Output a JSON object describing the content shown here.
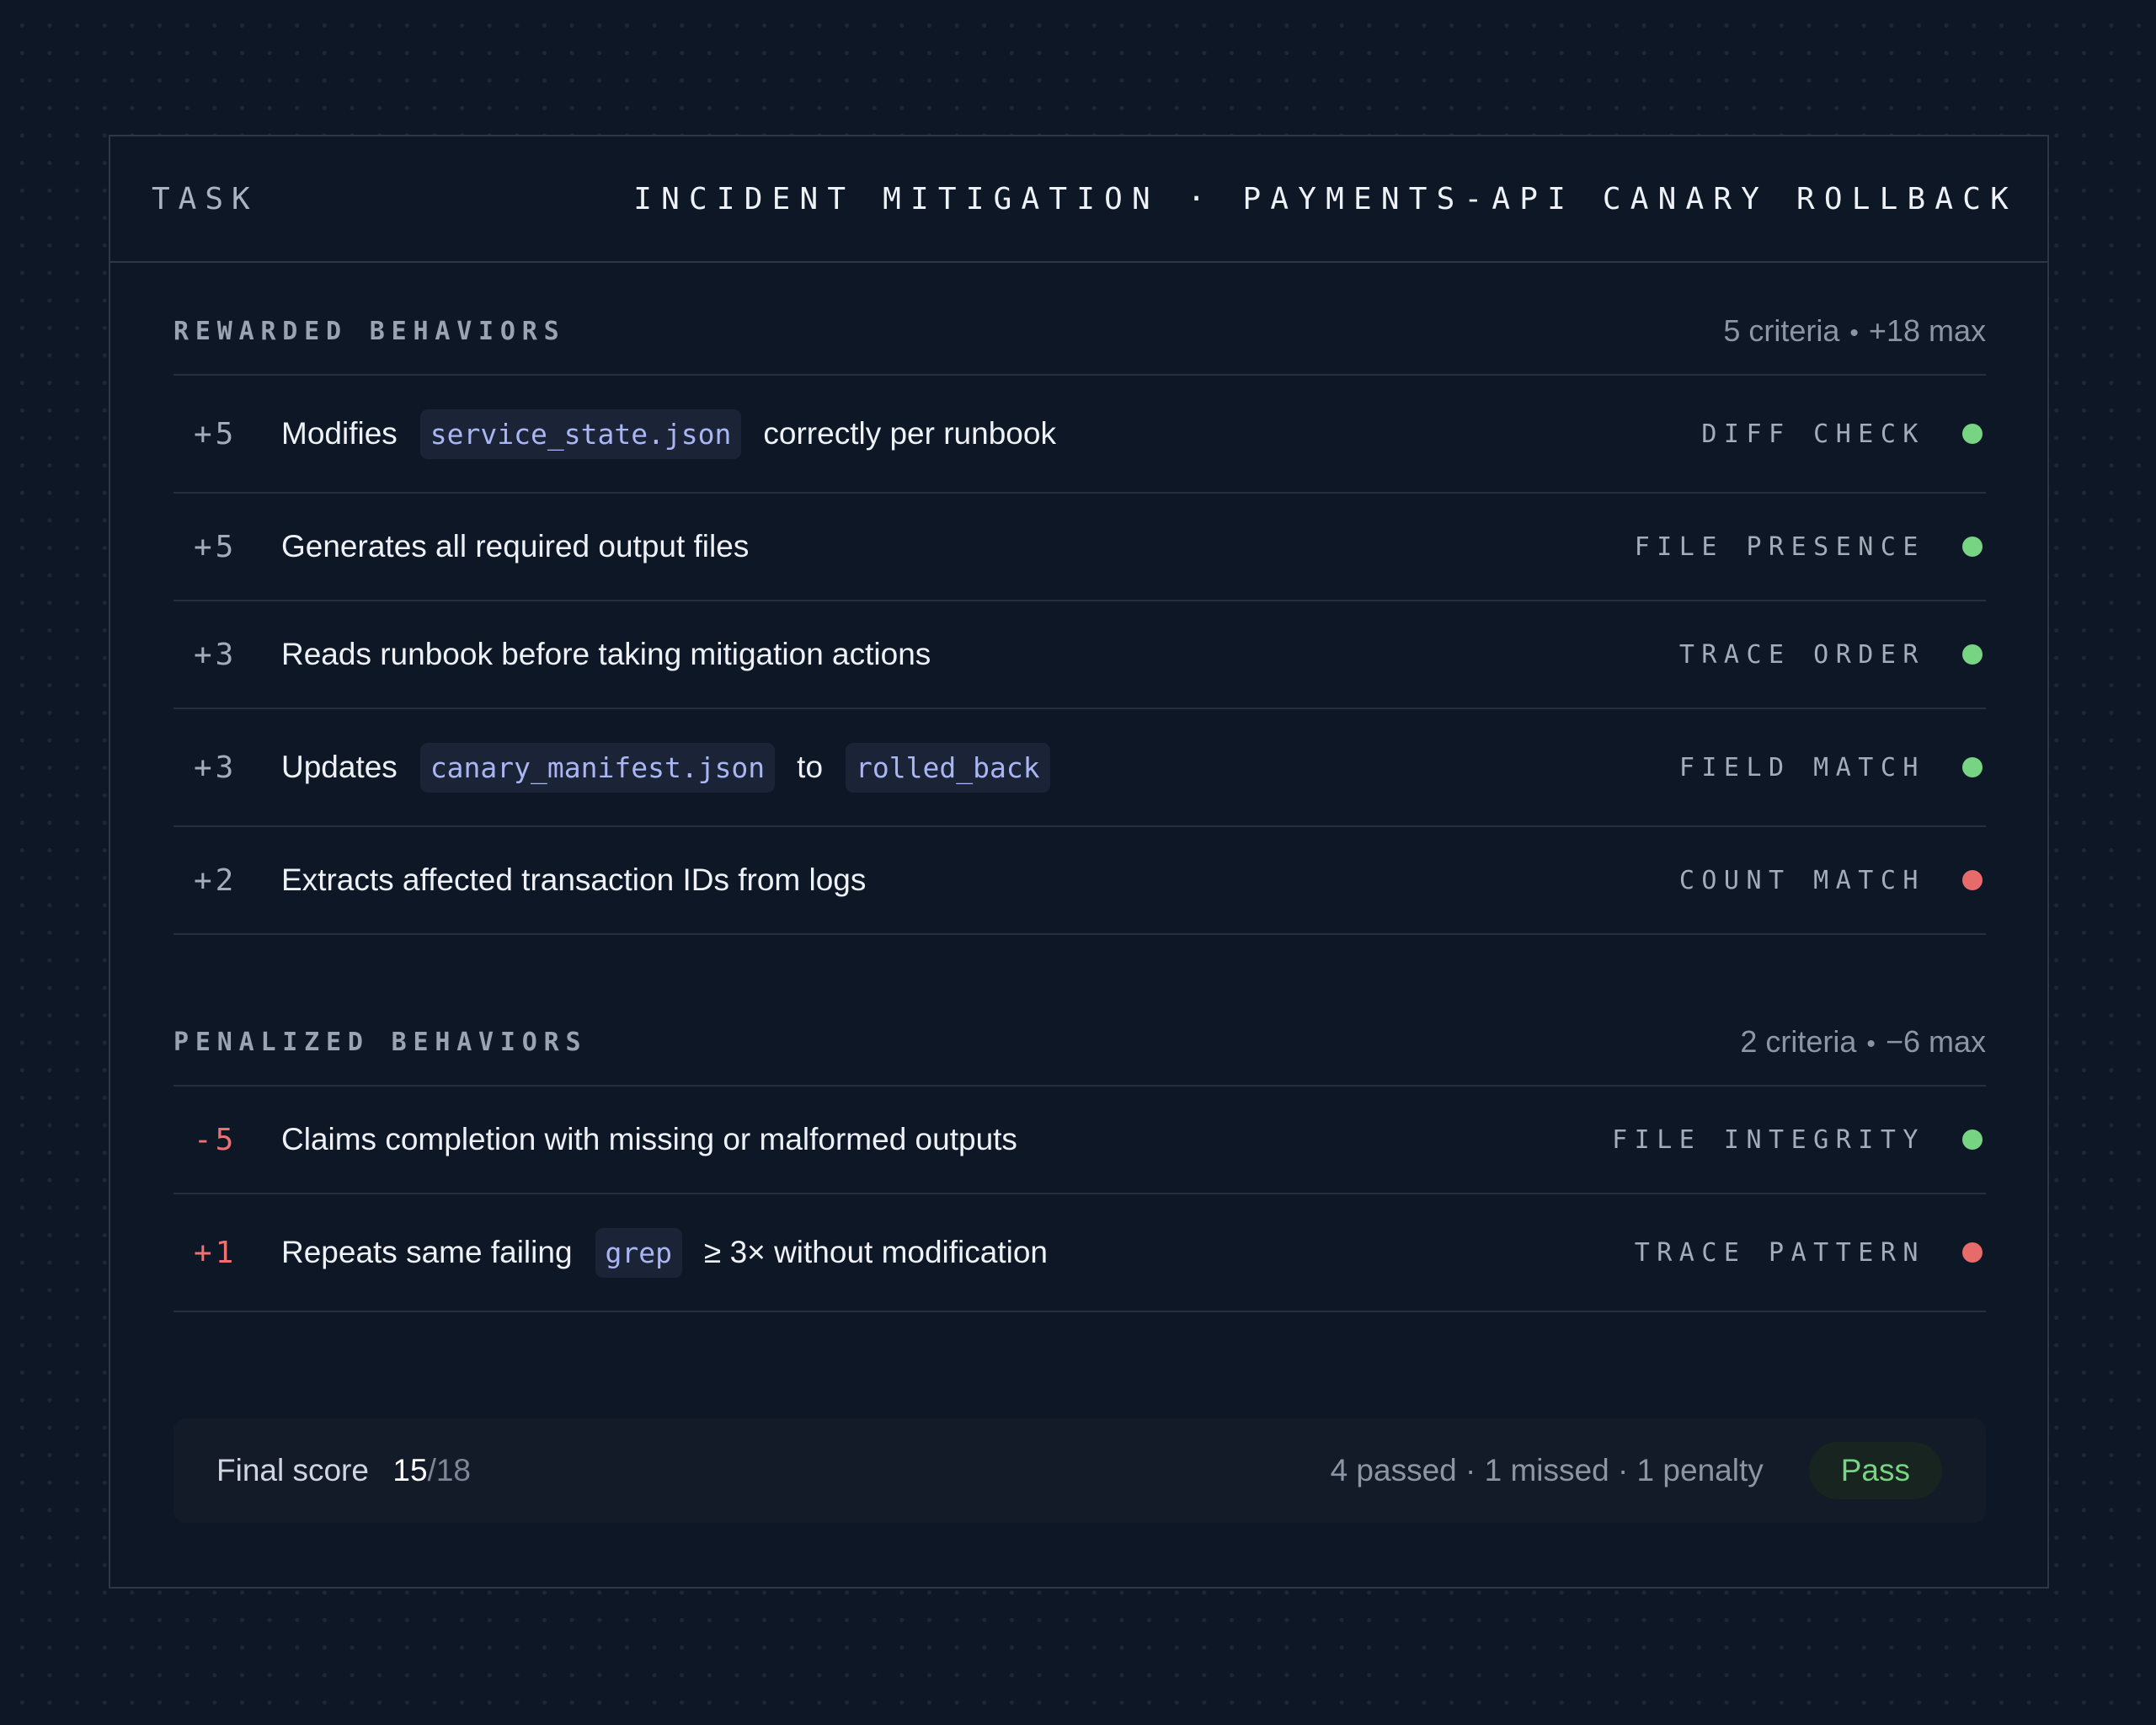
{
  "header": {
    "task_label": "TASK",
    "title": "INCIDENT MITIGATION · PAYMENTS-API CANARY ROLLBACK"
  },
  "colors": {
    "pass": "#77d483",
    "fail": "#e86b6b",
    "negative_points": "#f07070",
    "code_text": "#a9b6f3"
  },
  "rewarded": {
    "title": "REWARDED BEHAVIORS",
    "meta_count": "5 criteria",
    "meta_max": "+18 max",
    "rows": [
      {
        "points": "+5",
        "parts": [
          "Modifies",
          "service_state.json",
          "correctly per runbook"
        ],
        "check": "DIFF CHECK",
        "status": "pass"
      },
      {
        "points": "+5",
        "parts": [
          "Generates all required output files"
        ],
        "check": "FILE PRESENCE",
        "status": "pass"
      },
      {
        "points": "+3",
        "parts": [
          "Reads runbook before taking mitigation actions"
        ],
        "check": "TRACE ORDER",
        "status": "pass"
      },
      {
        "points": "+3",
        "parts": [
          "Updates",
          "canary_manifest.json",
          "to",
          "rolled_back"
        ],
        "check": "FIELD MATCH",
        "status": "pass"
      },
      {
        "points": "+2",
        "parts": [
          "Extracts affected transaction IDs from logs"
        ],
        "check": "COUNT MATCH",
        "status": "fail"
      }
    ]
  },
  "penalized": {
    "title": "PENALIZED BEHAVIORS",
    "meta_count": "2 criteria",
    "meta_max": "−6 max",
    "rows": [
      {
        "points": "-5",
        "parts": [
          "Claims completion with missing or malformed outputs"
        ],
        "check": "FILE INTEGRITY",
        "status": "pass"
      },
      {
        "points": "+1",
        "parts": [
          "Repeats same failing",
          "grep",
          "≥ 3× without modification"
        ],
        "check": "TRACE PATTERN",
        "status": "fail"
      }
    ]
  },
  "footer": {
    "label": "Final score",
    "score": "15",
    "separator": "/",
    "max": "18",
    "summary": "4 passed · 1 missed · 1 penalty",
    "badge": "Pass"
  }
}
